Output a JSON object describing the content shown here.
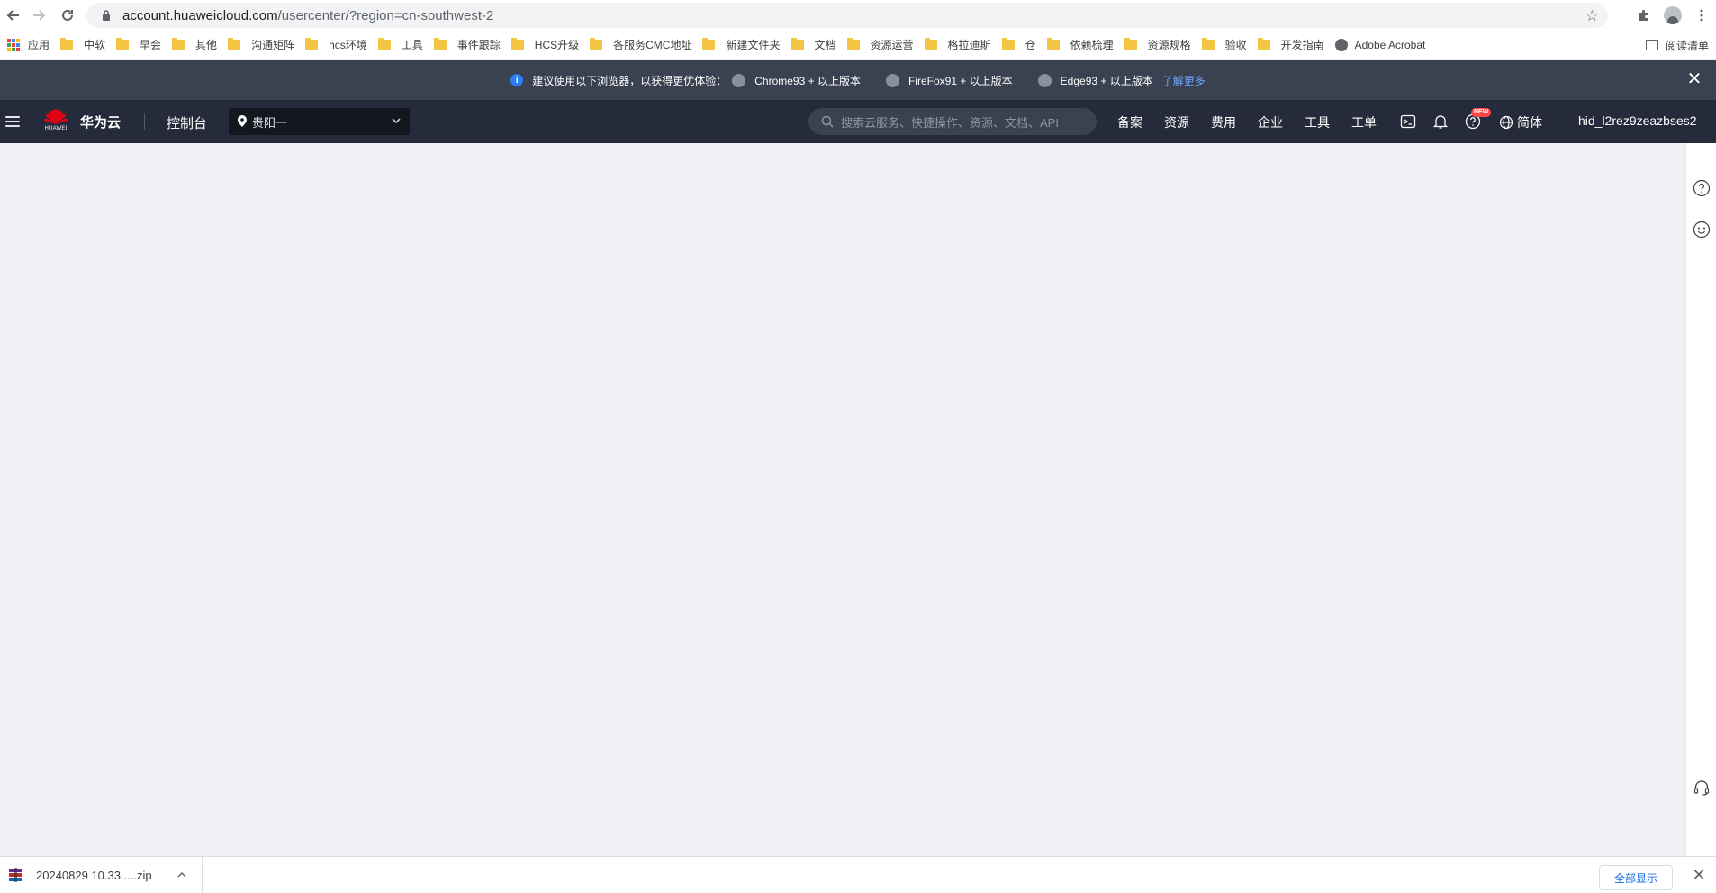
{
  "browser": {
    "url_host": "account.huaweicloud.com",
    "url_path": "/usercenter/?region=cn-southwest-2",
    "icons": [
      "back-icon",
      "forward-icon",
      "reload-icon",
      "lock-icon",
      "star-icon",
      "extensions-icon",
      "profile-icon",
      "kebab-menu-icon"
    ]
  },
  "bookmarks": {
    "apps_label": "应用",
    "items": [
      "中软",
      "早会",
      "其他",
      "沟通矩阵",
      "hcs环境",
      "工具",
      "事件跟踪",
      "HCS升级",
      "各服务CMC地址",
      "新建文件夹",
      "文档",
      "资源运营",
      "格拉迪斯",
      "仓",
      "依赖梳理",
      "资源规格",
      "验收",
      "开发指南"
    ],
    "acrobat_label": "Adobe Acrobat",
    "reading_list_label": "阅读清单"
  },
  "notice": {
    "message": "建议使用以下浏览器，以获得更优体验：",
    "browsers": [
      "Chrome93 + 以上版本",
      "FireFox91 + 以上版本",
      "Edge93 + 以上版本"
    ],
    "learn_more": "了解更多",
    "close_glyph": "✕"
  },
  "header": {
    "logo_text": "HUAWEI",
    "brand": "华为云",
    "console_label": "控制台",
    "region": "贵阳一",
    "search_placeholder": "搜索云服务、快捷操作、资源、文档、API",
    "menu": [
      "备案",
      "资源",
      "费用",
      "企业",
      "工具",
      "工单"
    ],
    "new_badge": "NEW",
    "language": "简体",
    "username": "hid_l2rez9zeazbses2"
  },
  "downloads": {
    "file_name": "20240829 10.33.....zip",
    "show_all": "全部显示",
    "close_glyph": "✕"
  },
  "colors": {
    "notice_bg": "#3a4150",
    "header_bg": "#252b3a",
    "page_bg": "#eff0f4",
    "link": "#6ea7ff",
    "badge": "#ff4949"
  }
}
